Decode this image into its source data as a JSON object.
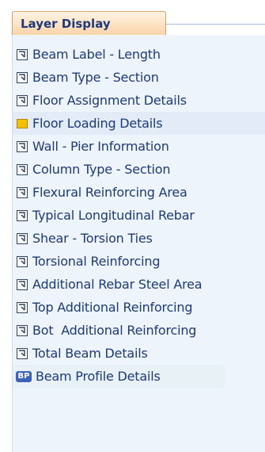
{
  "tab": {
    "title": "Layer Display"
  },
  "items": [
    {
      "label": "Beam Label - Length",
      "icon": "layer-toggle-icon"
    },
    {
      "label": "Beam Type - Section",
      "icon": "layer-toggle-icon"
    },
    {
      "label": "Floor Assignment Details",
      "icon": "layer-toggle-icon"
    },
    {
      "label": "Floor Loading Details",
      "icon": "layer-active-icon",
      "selected": true
    },
    {
      "label": "Wall - Pier Information",
      "icon": "layer-toggle-icon"
    },
    {
      "label": "Column Type - Section",
      "icon": "layer-toggle-icon"
    },
    {
      "label": "Flexural Reinforcing Area",
      "icon": "layer-toggle-icon"
    },
    {
      "label": "Typical Longitudinal Rebar",
      "icon": "layer-toggle-icon"
    },
    {
      "label": "Shear - Torsion Ties",
      "icon": "layer-toggle-icon"
    },
    {
      "label": "Torsional Reinforcing",
      "icon": "layer-toggle-icon"
    },
    {
      "label": "Additional Rebar Steel Area",
      "icon": "layer-toggle-icon"
    },
    {
      "label": "Top Additional Reinforcing",
      "icon": "layer-toggle-icon"
    },
    {
      "label": "Bot  Additional Reinforcing",
      "icon": "layer-toggle-icon"
    },
    {
      "label": "Total Beam Details",
      "icon": "layer-toggle-icon"
    }
  ],
  "profile": {
    "badge": "BP",
    "label": "Beam Profile Details",
    "icon": "beam-profile-icon"
  },
  "colors": {
    "text": "#1d3a7a",
    "tab_border": "#d9a06a",
    "active_icon": "#f2c200"
  }
}
